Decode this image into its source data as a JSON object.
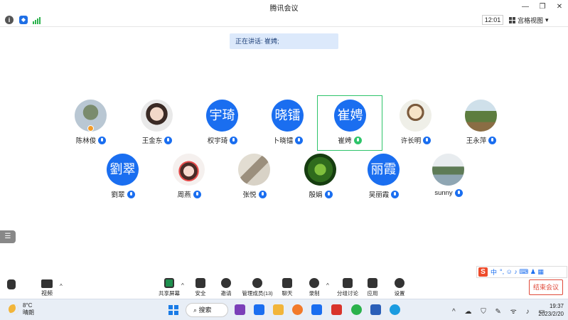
{
  "window": {
    "title": "腾讯会议",
    "controls": [
      "—",
      "❐",
      "✕"
    ]
  },
  "infobar": {
    "time": "12:01",
    "view_label": "宫格视图",
    "view_caret": "▾"
  },
  "speaking": {
    "text": "正在讲话: 崔娉;"
  },
  "participants_row1": [
    {
      "name": "陈林俊",
      "avatar_text": "",
      "photo": true,
      "host": true
    },
    {
      "name": "王金东",
      "avatar_text": "",
      "photo": true
    },
    {
      "name": "权宇琦",
      "avatar_text": "宇琦"
    },
    {
      "name": "卜晓镭",
      "avatar_text": "晓镭"
    },
    {
      "name": "崔娉",
      "avatar_text": "崔娉",
      "active": true
    },
    {
      "name": "许长明",
      "avatar_text": "",
      "photo": true
    },
    {
      "name": "王永萍",
      "avatar_text": "",
      "photo": true
    }
  ],
  "participants_row2": [
    {
      "name": "劉翠",
      "avatar_text": "劉翠"
    },
    {
      "name": "周燕",
      "avatar_text": "",
      "photo": true
    },
    {
      "name": "张悦",
      "avatar_text": "",
      "photo": true
    },
    {
      "name": "殷娟",
      "avatar_text": "",
      "photo": true
    },
    {
      "name": "吴丽霞",
      "avatar_text": "丽霞"
    },
    {
      "name": "sunny",
      "avatar_text": "",
      "photo": true
    }
  ],
  "ime": {
    "logo": "S",
    "mode": "中",
    "extras": "°, ☺ ♪ ⌨ ♟ ▦"
  },
  "toolbar": {
    "share": "共享屏幕",
    "security": "安全",
    "invite": "邀请",
    "members": "管理成员(13)",
    "chat": "聊天",
    "record": "录制",
    "breakout": "分组讨论",
    "apps": "应用",
    "settings": "设置",
    "video": "视频",
    "end": "结束会议",
    "caret": "^"
  },
  "taskbar": {
    "weather_temp": "8°C",
    "weather_desc": "晴朗",
    "search": "搜索",
    "time": "19:37",
    "date": "2023/2/20",
    "tray": "^ ☁ ⛉ ✎ ᯤ ♪ ▭"
  }
}
